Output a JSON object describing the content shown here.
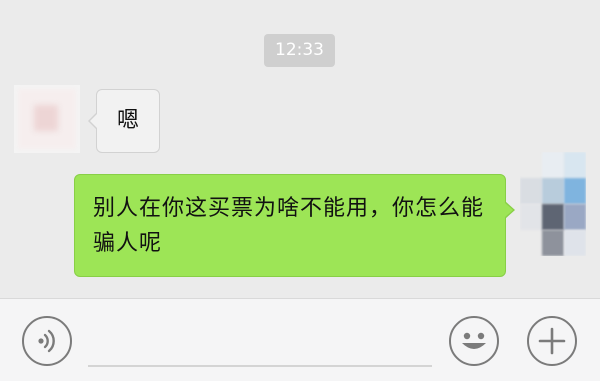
{
  "chat": {
    "timestamp": "12:33",
    "messages": [
      {
        "side": "left",
        "text": "嗯"
      },
      {
        "side": "right",
        "text": "别人在你这买票为啥不能用，你怎么能骗人呢"
      }
    ]
  },
  "input_bar": {
    "voice_icon": "voice-wave-icon",
    "emoji_icon": "smiley-face-icon",
    "plus_icon": "plus-icon",
    "text_value": ""
  },
  "colors": {
    "background": "#ebebeb",
    "received_bubble": "#f2f2f2",
    "sent_bubble": "#9de556",
    "timestamp_bg": "#cfcfcf"
  }
}
